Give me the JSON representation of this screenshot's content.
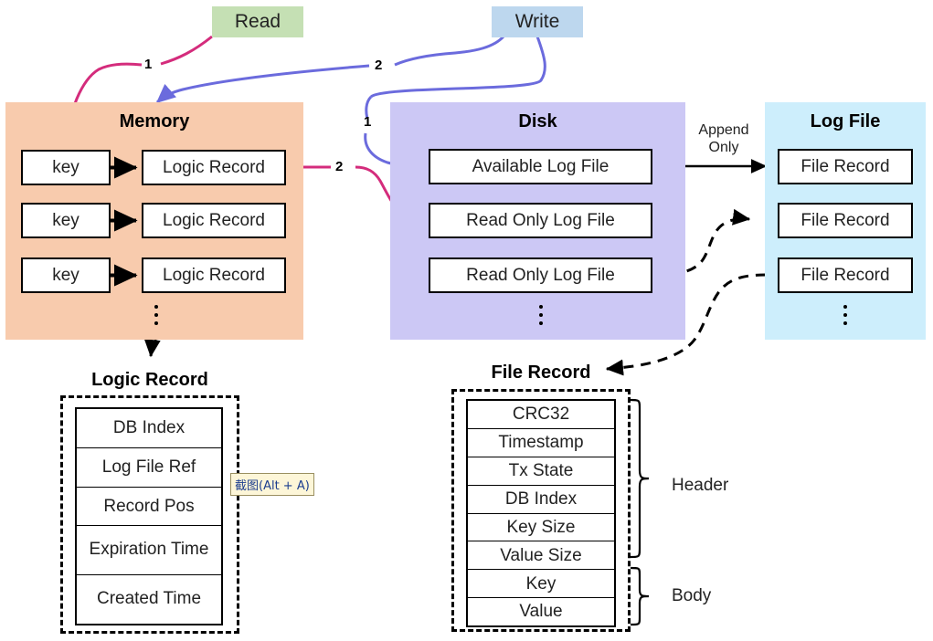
{
  "diagram": {
    "title": "Bitcask-style storage engine diagram",
    "actions": [
      {
        "id": "read",
        "label": "Read",
        "color": "#c5e0b4"
      },
      {
        "id": "write",
        "label": "Write",
        "color": "#bdd7ee"
      }
    ],
    "panels": {
      "memory": {
        "title": "Memory",
        "color": "#f8cbad",
        "rows": [
          {
            "key": "key",
            "record": "Logic Record"
          },
          {
            "key": "key",
            "record": "Logic Record"
          },
          {
            "key": "key",
            "record": "Logic Record"
          }
        ],
        "ellipsis": "⋮"
      },
      "disk": {
        "title": "Disk",
        "color": "#ccc8f5",
        "files": [
          "Available Log File",
          "Read Only Log File",
          "Read Only Log File"
        ],
        "ellipsis": "⋮"
      },
      "logfile": {
        "title": "Log File",
        "color": "#cdeefc",
        "records": [
          "File Record",
          "File Record",
          "File Record"
        ],
        "ellipsis": "⋮"
      }
    },
    "edge_labels": {
      "read_step": "1",
      "write_step": "2",
      "write_disk_step": "1",
      "read_disk_step": "2",
      "append_only": "Append\nOnly",
      "append_only_line1": "Append",
      "append_only_line2": "Only"
    },
    "logic_record_detail": {
      "title": "Logic Record",
      "fields": [
        "DB Index",
        "Log File Ref",
        "Record Pos",
        "Expiration Time",
        "Created Time"
      ]
    },
    "file_record_detail": {
      "title": "File Record",
      "fields": [
        "CRC32",
        "Timestamp",
        "Tx State",
        "DB Index",
        "Key Size",
        "Value Size",
        "Key",
        "Value"
      ],
      "groups": [
        {
          "label": "Header",
          "from": 0,
          "to": 5
        },
        {
          "label": "Body",
          "from": 6,
          "to": 7
        }
      ]
    },
    "tooltip": {
      "text": "截图(Alt + A)"
    },
    "colors": {
      "read_pill": "#c5e0b4",
      "write_pill": "#bdd7ee",
      "memory_panel": "#f8cbad",
      "disk_panel": "#ccc8f5",
      "log_panel": "#cdeefc",
      "read_arrow": "#d42c7c",
      "write_arrow": "#6b6bdd",
      "solid_arrow": "#000000",
      "box_border": "#000000"
    }
  }
}
